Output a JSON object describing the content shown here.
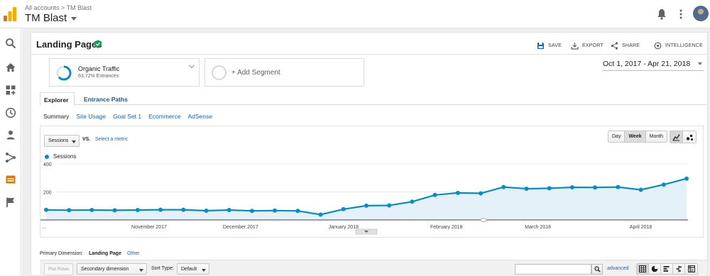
{
  "header": {
    "breadcrumb": "All accounts > TM Blast",
    "account_title": "TM Blast"
  },
  "report": {
    "title": "Landing Pages",
    "actions": {
      "save": "SAVE",
      "export": "EXPORT",
      "share": "SHARE",
      "intelligence": "INTELLIGENCE"
    }
  },
  "segments": [
    {
      "name": "Organic Traffic",
      "detail": "63.72% Entrances",
      "share": 0.6372
    },
    {
      "name": "+ Add Segment"
    }
  ],
  "date_range": "Oct 1, 2017 - Apr 21, 2018",
  "tabs": [
    "Explorer",
    "Entrance Paths"
  ],
  "subnav": [
    "Summary",
    "Site Usage",
    "Goal Set 1",
    "Ecommerce",
    "AdSense"
  ],
  "chart_controls": {
    "metric": "Sessions",
    "vs": "VS.",
    "select_metric": "Select a metric",
    "granularity": [
      "Day",
      "Week",
      "Month"
    ],
    "selected_granularity": "Week"
  },
  "legend": "Sessions",
  "chart_data": {
    "type": "area",
    "series_name": "Sessions",
    "ylim": [
      0,
      400
    ],
    "yticks": [
      "400",
      "200"
    ],
    "x_start_label": "...",
    "month_labels": [
      "November 2017",
      "December 2017",
      "January 2018",
      "February 2018",
      "March 2018",
      "April 2018"
    ],
    "month_label_week_index": [
      4.5,
      8.5,
      13,
      17.5,
      21.5,
      26
    ],
    "values": [
      72,
      70,
      71,
      69,
      71,
      73,
      73,
      66,
      71,
      65,
      67,
      65,
      38,
      77,
      102,
      104,
      130,
      178,
      193,
      190,
      235,
      223,
      226,
      233,
      232,
      235,
      215,
      252,
      295
    ],
    "color": "#058dc7",
    "fill": "#e4f1f9"
  },
  "table_controls": {
    "primary_dimension_label": "Primary Dimension:",
    "primary_dimension": "Landing Page",
    "other": "Other",
    "plot_rows": "Plot Rows",
    "secondary_dimension": "Secondary dimension",
    "sort_type_label": "Sort Type:",
    "sort_type": "Default",
    "advanced": "advanced"
  }
}
